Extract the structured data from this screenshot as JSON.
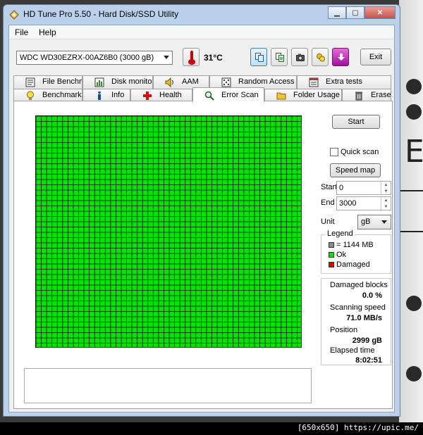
{
  "window": {
    "title": "HD Tune Pro 5.50 - Hard Disk/SSD Utility"
  },
  "menu": {
    "file": "File",
    "help": "Help"
  },
  "toolbar": {
    "drive": "WDC WD30EZRX-00AZ6B0 (3000 gB)",
    "temperature": "31",
    "temperature_unit": "°C",
    "exit_label": "Exit"
  },
  "tabs": {
    "row1": [
      "File Benchmark",
      "Disk monitor",
      "AAM",
      "Random Access",
      "Extra tests"
    ],
    "row2": [
      "Benchmark",
      "Info",
      "Health",
      "Error Scan",
      "Folder Usage",
      "Erase"
    ]
  },
  "controls": {
    "start_button": "Start",
    "quick_scan": "Quick scan",
    "speed_map_button": "Speed map",
    "start_label": "Start",
    "start_value": "0",
    "end_label": "End",
    "end_value": "3000",
    "unit_label": "Unit",
    "unit_value": "gB"
  },
  "legend": {
    "title": "Legend",
    "block_size": "= 1144 MB",
    "ok": "Ok",
    "damaged": "Damaged"
  },
  "stats": {
    "damaged_blocks_label": "Damaged blocks",
    "damaged_blocks_value": "0.0 %",
    "scanning_speed_label": "Scanning speed",
    "scanning_speed_value": "71.0 MB/s",
    "position_label": "Position",
    "position_value": "2999 gB",
    "elapsed_time_label": "Elapsed time",
    "elapsed_time_value": "8:02:51"
  },
  "scan": {
    "ok_fraction": 1.0,
    "damaged_fraction": 0.0
  },
  "watermark": "[650x650] https://upic.me/",
  "colors": {
    "ok": "#00e400",
    "damaged": "#e00000",
    "grid_line": "#1a1a1a",
    "block_legend": "#8a8a8a"
  },
  "background": {
    "side_text": "E"
  }
}
